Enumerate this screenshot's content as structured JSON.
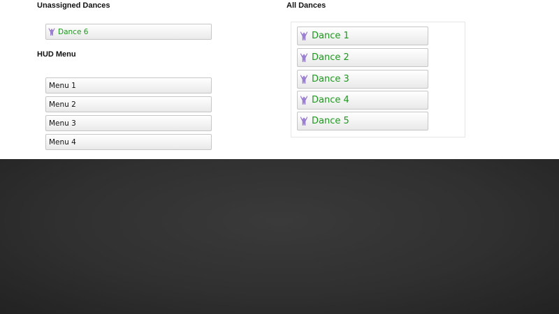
{
  "colors": {
    "dance_text": "#1a9a1a",
    "dance_icon": "#9b7fd0",
    "menu_text": "#111111",
    "dark_background": "#303030"
  },
  "unassigned": {
    "heading": "Unassigned Dances",
    "items": [
      {
        "label": "Dance 6",
        "icon": "dancer-icon"
      }
    ]
  },
  "hud_menu": {
    "heading": "HUD Menu",
    "items": [
      {
        "label": "Menu 1"
      },
      {
        "label": "Menu 2"
      },
      {
        "label": "Menu 3"
      },
      {
        "label": "Menu 4"
      }
    ]
  },
  "all_dances": {
    "heading": "All Dances",
    "items": [
      {
        "label": "Dance 1",
        "icon": "dancer-icon"
      },
      {
        "label": "Dance 2",
        "icon": "dancer-icon"
      },
      {
        "label": "Dance 3",
        "icon": "dancer-icon"
      },
      {
        "label": "Dance 4",
        "icon": "dancer-icon"
      },
      {
        "label": "Dance 5",
        "icon": "dancer-icon"
      }
    ]
  }
}
